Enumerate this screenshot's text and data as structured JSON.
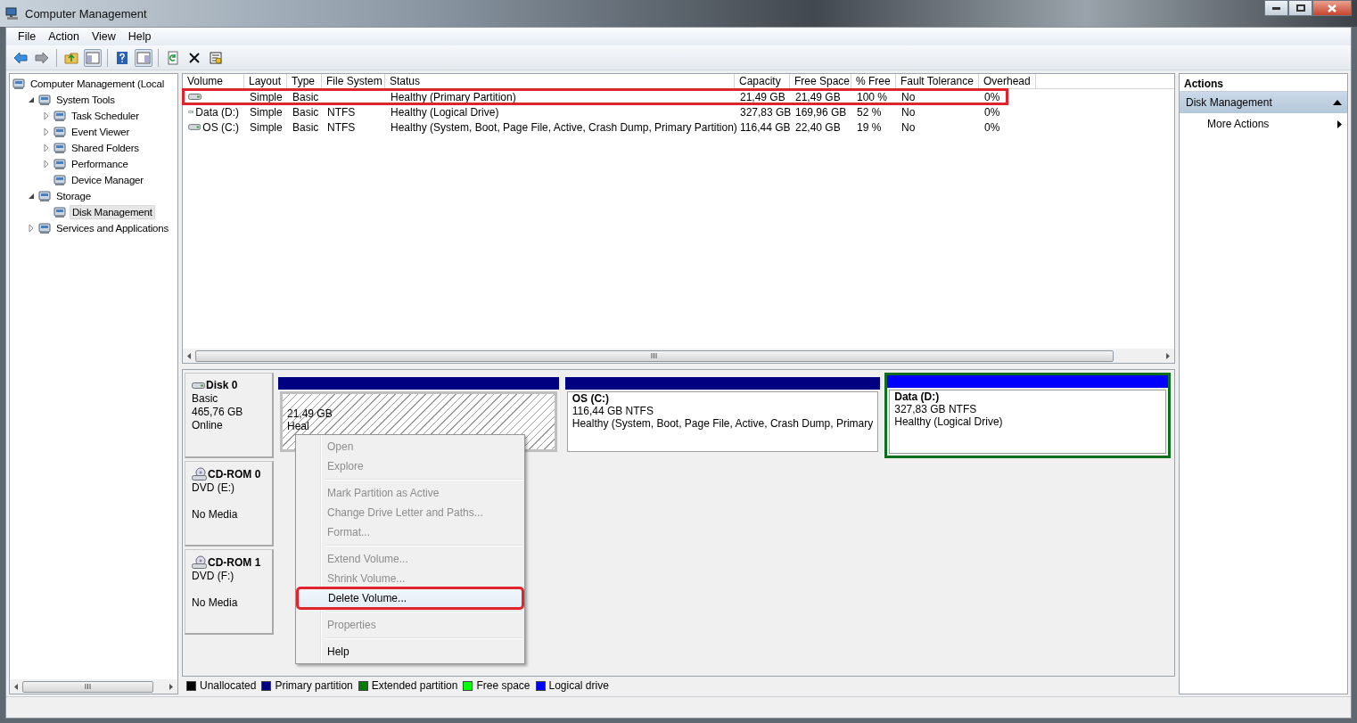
{
  "window": {
    "title": "Computer Management"
  },
  "menu": [
    "File",
    "Action",
    "View",
    "Help"
  ],
  "tree": [
    {
      "label": "Computer Management (Local",
      "selected": false,
      "children": [
        {
          "label": "System Tools",
          "selected": false,
          "expanded": true,
          "children": [
            {
              "label": "Task Scheduler",
              "selected": false,
              "expanded": false
            },
            {
              "label": "Event Viewer",
              "selected": false,
              "expanded": false
            },
            {
              "label": "Shared Folders",
              "selected": false,
              "expanded": false
            },
            {
              "label": "Performance",
              "selected": false,
              "expanded": false
            },
            {
              "label": "Device Manager",
              "selected": false
            }
          ]
        },
        {
          "label": "Storage",
          "selected": false,
          "expanded": true,
          "children": [
            {
              "label": "Disk Management",
              "selected": true
            }
          ]
        },
        {
          "label": "Services and Applications",
          "selected": false,
          "expanded": false
        }
      ]
    }
  ],
  "volumes": {
    "columns": [
      "Volume",
      "Layout",
      "Type",
      "File System",
      "Status",
      "Capacity",
      "Free Space",
      "% Free",
      "Fault Tolerance",
      "Overhead"
    ],
    "rows": [
      {
        "highlighted": true,
        "cells": [
          null,
          "Simple",
          "Basic",
          null,
          "Healthy (Primary Partition)",
          "21,49 GB",
          "21,49 GB",
          "100 %",
          "No",
          "0%"
        ]
      },
      {
        "highlighted": false,
        "cells": [
          "Data (D:)",
          "Simple",
          "Basic",
          "NTFS",
          "Healthy (Logical Drive)",
          "327,83 GB",
          "169,96 GB",
          "52 %",
          "No",
          "0%"
        ]
      },
      {
        "highlighted": false,
        "cells": [
          "OS (C:)",
          "Simple",
          "Basic",
          "NTFS",
          "Healthy (System, Boot, Page File, Active, Crash Dump, Primary Partition)",
          "116,44 GB",
          "22,40 GB",
          "19 %",
          "No",
          "0%"
        ]
      }
    ]
  },
  "disks": [
    {
      "kind": "disk",
      "name": "Disk 0",
      "type": "Basic",
      "size": "465,76 GB",
      "status": "Online",
      "partitions": [
        {
          "kind": "primary",
          "selected": true,
          "extended": false,
          "size": "21,49 GB",
          "status": "Heal"
        },
        {
          "kind": "primary",
          "selected": false,
          "extended": false,
          "name": "OS  (C:)",
          "size": "116,44 GB NTFS",
          "status": "Healthy (System, Boot, Page File, Active, Crash Dump, Primary"
        },
        {
          "kind": "logical",
          "selected": false,
          "extended": true,
          "name": "Data  (D:)",
          "size": "327,83 GB NTFS",
          "status": "Healthy (Logical Drive)"
        }
      ]
    },
    {
      "kind": "cdrom",
      "name": "CD-ROM 0",
      "type": "DVD (E:)",
      "status": "No Media"
    },
    {
      "kind": "cdrom",
      "name": "CD-ROM 1",
      "type": "DVD (F:)",
      "status": "No Media"
    }
  ],
  "legend": [
    {
      "label": "Unallocated",
      "color": "#000000"
    },
    {
      "label": "Primary partition",
      "color": "#000080"
    },
    {
      "label": "Extended partition",
      "color": "#008000"
    },
    {
      "label": "Free space",
      "color": "#00ff00"
    },
    {
      "label": "Logical drive",
      "color": "#0000ff"
    }
  ],
  "context_menu": [
    {
      "kind": "item",
      "label": "Open",
      "disabled": true,
      "selected": false,
      "highlighted": false
    },
    {
      "kind": "item",
      "label": "Explore",
      "disabled": true,
      "selected": false,
      "highlighted": false
    },
    {
      "kind": "separator"
    },
    {
      "kind": "item",
      "label": "Mark Partition as Active",
      "disabled": true,
      "selected": false,
      "highlighted": false
    },
    {
      "kind": "item",
      "label": "Change Drive Letter and Paths...",
      "disabled": true,
      "selected": false,
      "highlighted": false
    },
    {
      "kind": "item",
      "label": "Format...",
      "disabled": true,
      "selected": false,
      "highlighted": false
    },
    {
      "kind": "separator"
    },
    {
      "kind": "item",
      "label": "Extend Volume...",
      "disabled": true,
      "selected": false,
      "highlighted": false
    },
    {
      "kind": "item",
      "label": "Shrink Volume...",
      "disabled": true,
      "selected": false,
      "highlighted": false
    },
    {
      "kind": "item",
      "label": "Delete Volume...",
      "disabled": false,
      "selected": true,
      "highlighted": true
    },
    {
      "kind": "separator"
    },
    {
      "kind": "item",
      "label": "Properties",
      "disabled": true,
      "selected": false,
      "highlighted": false
    },
    {
      "kind": "separator"
    },
    {
      "kind": "item",
      "label": "Help",
      "disabled": false,
      "selected": false,
      "highlighted": false
    }
  ],
  "actions": {
    "title": "Actions",
    "sections": [
      {
        "label": "Disk Management",
        "expanded": true,
        "items": [
          {
            "label": "More Actions",
            "submenu": true
          }
        ]
      }
    ]
  }
}
